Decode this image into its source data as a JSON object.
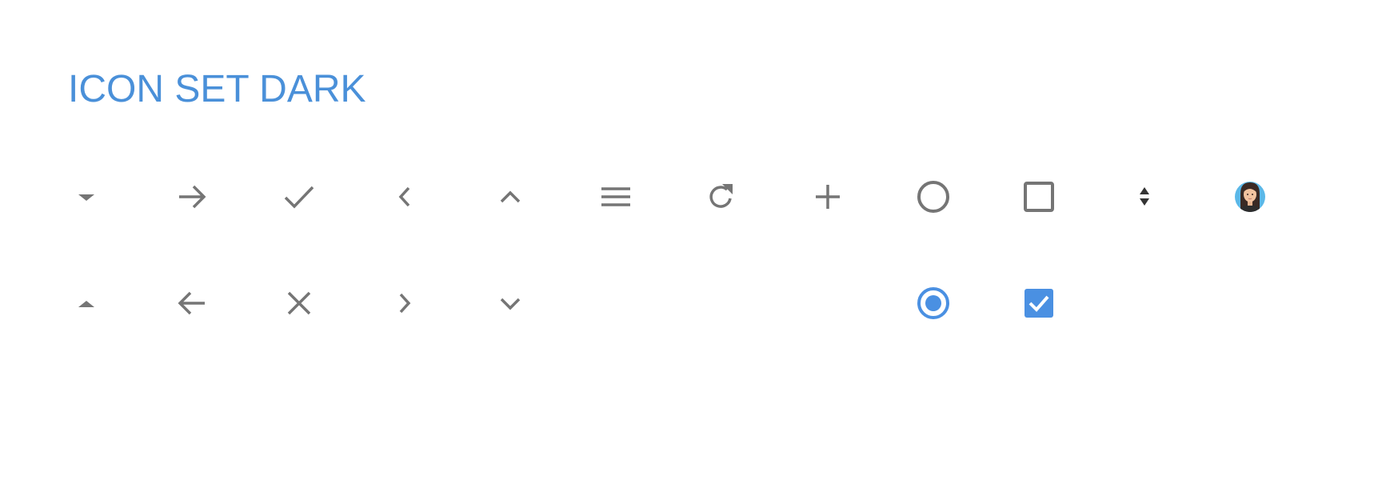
{
  "title": "ICON SET DARK",
  "colors": {
    "title": "#4a90d9",
    "icon_gray": "#757575",
    "accent_blue": "#4a90e2",
    "icon_dark": "#333333",
    "avatar_bg": "#5bb8e8"
  },
  "icons": {
    "row1": [
      "caret-down-icon",
      "arrow-right-icon",
      "checkmark-icon",
      "chevron-left-icon",
      "chevron-up-icon",
      "hamburger-menu-icon",
      "refresh-icon",
      "plus-icon",
      "radio-unchecked-icon",
      "checkbox-unchecked-icon",
      "sort-up-down-icon",
      "avatar-icon"
    ],
    "row2": [
      "caret-up-icon",
      "arrow-left-icon",
      "close-x-icon",
      "chevron-right-icon",
      "chevron-down-icon",
      "radio-checked-icon",
      "checkbox-checked-icon"
    ]
  }
}
